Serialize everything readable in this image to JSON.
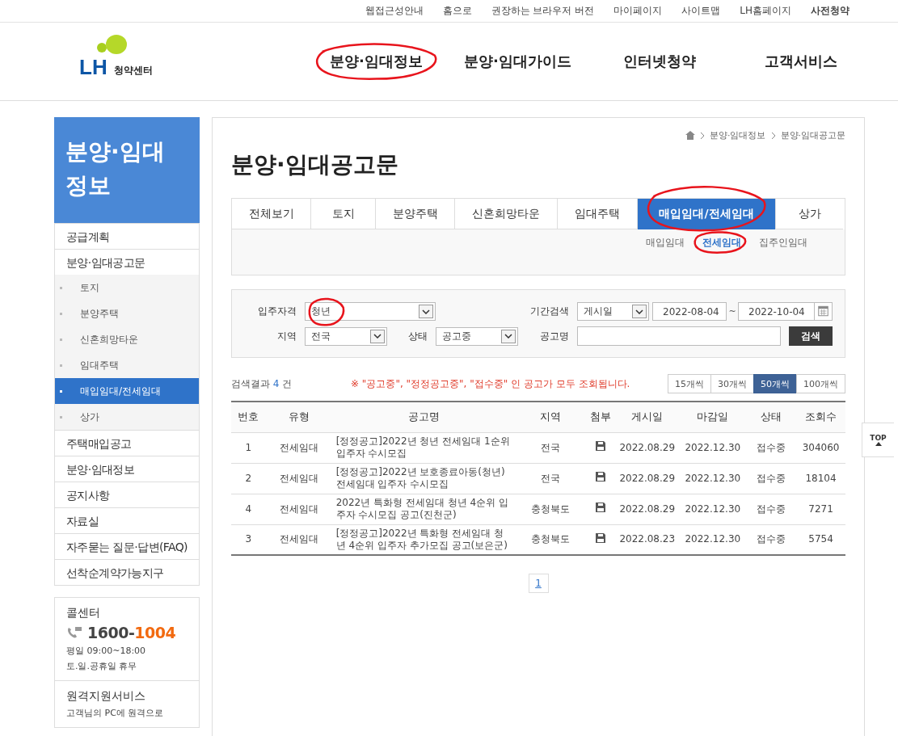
{
  "utility_links": [
    {
      "label": "웹접근성안내",
      "bold": false
    },
    {
      "label": "홈으로",
      "bold": false
    },
    {
      "label": "권장하는 브라우저 버전",
      "bold": false
    },
    {
      "label": "마이페이지",
      "bold": false
    },
    {
      "label": "사이트맵",
      "bold": false
    },
    {
      "label": "LH홈페이지",
      "bold": false
    },
    {
      "label": "사전청약",
      "bold": true
    }
  ],
  "logo": {
    "mark": "LH",
    "text": "청약센터"
  },
  "main_nav": [
    {
      "label": "분양·임대정보",
      "circled": true
    },
    {
      "label": "분양·임대가이드",
      "circled": false
    },
    {
      "label": "인터넷청약",
      "circled": false
    },
    {
      "label": "고객서비스",
      "circled": false
    }
  ],
  "sidebar": {
    "title": "분양·임대 정보",
    "items": [
      {
        "label": "공급계획"
      },
      {
        "label": "분양·임대공고문",
        "children": [
          {
            "label": "토지",
            "selected": false
          },
          {
            "label": "분양주택",
            "selected": false
          },
          {
            "label": "신혼희망타운",
            "selected": false
          },
          {
            "label": "임대주택",
            "selected": false
          },
          {
            "label": "매입임대/전세임대",
            "selected": true
          },
          {
            "label": "상가",
            "selected": false
          }
        ]
      },
      {
        "label": "주택매입공고"
      },
      {
        "label": "분양·임대정보"
      },
      {
        "label": "공지사항"
      },
      {
        "label": "자료실"
      },
      {
        "label": "자주묻는 질문·답변(FAQ)"
      },
      {
        "label": "선착순계약가능지구"
      }
    ]
  },
  "call_center": {
    "title": "콜센터",
    "number_prefix": "1600-",
    "number_suffix": "1004",
    "hours": "평일 09:00~18:00",
    "closed": "토.일.공휴일 휴무"
  },
  "remote_support": {
    "title": "원격지원서비스",
    "text": "고객님의 PC에 원격으로"
  },
  "breadcrumb": [
    "분양·임대정보",
    "분양·임대공고문"
  ],
  "page_title": "분양·임대공고문",
  "tabs": [
    {
      "label": "전체보기",
      "selected": false,
      "circled": false
    },
    {
      "label": "토지",
      "selected": false,
      "circled": false
    },
    {
      "label": "분양주택",
      "selected": false,
      "circled": false
    },
    {
      "label": "신혼희망타운",
      "selected": false,
      "circled": false
    },
    {
      "label": "임대주택",
      "selected": false,
      "circled": false
    },
    {
      "label": "매입임대/전세임대",
      "selected": true,
      "circled": true
    },
    {
      "label": "상가",
      "selected": false,
      "circled": false
    }
  ],
  "subtabs": [
    {
      "label": "매입임대",
      "selected": false,
      "circled": false
    },
    {
      "label": "전세임대",
      "selected": true,
      "circled": true
    },
    {
      "label": "집주인임대",
      "selected": false,
      "circled": false
    }
  ],
  "filters": {
    "qualification": {
      "label": "입주자격",
      "value": "청년",
      "circled": true
    },
    "period": {
      "label": "기간검색",
      "value": "게시일",
      "from": "2022-08-04",
      "tilde": "~",
      "to": "2022-10-04"
    },
    "region": {
      "label": "지역",
      "value": "전국"
    },
    "status": {
      "label": "상태",
      "value": "공고중"
    },
    "name": {
      "label": "공고명"
    },
    "search_button": "검색"
  },
  "results": {
    "prefix": "검색결과",
    "count": "4",
    "suffix": "건",
    "notice": "※ \"공고중\", \"정정공고중\", \"접수중\" 인 공고가 모두 조회됩니다."
  },
  "page_sizes": [
    {
      "label": "15개씩",
      "selected": false
    },
    {
      "label": "30개씩",
      "selected": false
    },
    {
      "label": "50개씩",
      "selected": true
    },
    {
      "label": "100개씩",
      "selected": false
    }
  ],
  "table": {
    "columns": [
      "번호",
      "유형",
      "공고명",
      "지역",
      "첨부",
      "게시일",
      "마감일",
      "상태",
      "조회수"
    ],
    "rows": [
      [
        "1",
        "전세임대",
        "[정정공고]2022년 청년 전세임대 1순위 입주자 수시모집",
        "전국",
        "",
        "2022.08.29",
        "2022.12.30",
        "접수중",
        "304060"
      ],
      [
        "2",
        "전세임대",
        "[정정공고]2022년 보호종료아동(청년) 전세임대 입주자 수시모집",
        "전국",
        "",
        "2022.08.29",
        "2022.12.30",
        "접수중",
        "18104"
      ],
      [
        "4",
        "전세임대",
        "2022년 특화형 전세임대 청년 4순위 입주자 수시모집 공고(진천군)",
        "충청북도",
        "",
        "2022.08.29",
        "2022.12.30",
        "접수중",
        "7271"
      ],
      [
        "3",
        "전세임대",
        "[정정공고]2022년 특화형 전세임대 청년 4순위 입주자 추가모집 공고(보은군)",
        "충청북도",
        "",
        "2022.08.23",
        "2022.12.30",
        "접수중",
        "5754"
      ]
    ]
  },
  "pagination": [
    {
      "label": "1",
      "selected": true
    }
  ],
  "top_button": "TOP"
}
